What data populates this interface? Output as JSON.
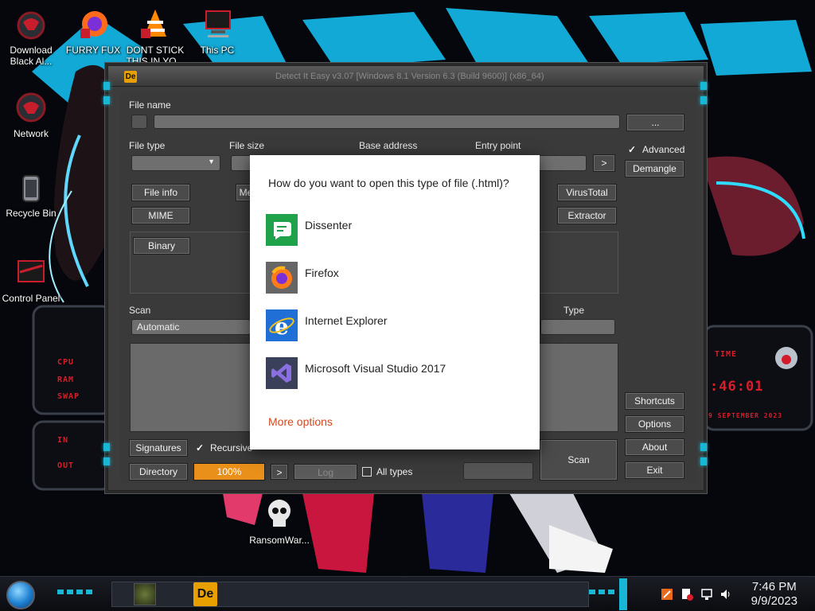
{
  "desktop": {
    "icons": [
      {
        "label": "Download Black Al..."
      },
      {
        "label": "FURRY FUX"
      },
      {
        "label": "DONT STICK THIS IN YO..."
      },
      {
        "label": "This PC"
      },
      {
        "label": "Network"
      },
      {
        "label": "Recycle Bin"
      },
      {
        "label": "Control Panel"
      },
      {
        "label": "RansomWar..."
      }
    ]
  },
  "hud_left": {
    "cpu": "CPU",
    "ram": "RAM",
    "swap": "SWAP",
    "in": "IN",
    "out": "OUT"
  },
  "hud_right": {
    "time_label": "TIME",
    "time_value": ":46:01",
    "date": "9 SEPTEMBER 2023"
  },
  "app": {
    "title": "Detect It Easy v3.07 [Windows 8.1 Version 6.3 (Build 9600)] (x86_64)",
    "logo": "De",
    "labels": {
      "file_name": "File name",
      "file_type": "File type",
      "file_size": "File size",
      "base_address": "Base address",
      "entry_point": "Entry point",
      "scan": "Scan",
      "type": "Type"
    },
    "file_name_browse": "...",
    "entry_point_go": ">",
    "advanced_label": "Advanced",
    "buttons": {
      "demangle": "Demangle",
      "file_info": "File info",
      "memory_map": "Me",
      "virustotal": "VirusTotal",
      "mime": "MIME",
      "extractor": "Extractor",
      "binary": "Binary",
      "shortcuts": "Shortcuts",
      "options": "Options",
      "about": "About",
      "exit": "Exit",
      "signatures": "Signatures",
      "directory": "Directory",
      "scan": "Scan",
      "next": ">",
      "log": "Log"
    },
    "scan_mode": "Automatic",
    "recursive_label": "Recursive",
    "all_types_label": "All types",
    "progress_text": "100%"
  },
  "open_with": {
    "title": "How do you want to open this type of file (.html)?",
    "apps": [
      {
        "name": "Dissenter",
        "icon": "dissenter-icon"
      },
      {
        "name": "Firefox",
        "icon": "firefox-icon"
      },
      {
        "name": "Internet Explorer",
        "icon": "internet-explorer-icon"
      },
      {
        "name": "Microsoft Visual Studio 2017",
        "icon": "visual-studio-icon"
      }
    ],
    "more_options": "More options"
  },
  "taskbar": {
    "pinned_app_logo": "De",
    "time": "7:46 PM",
    "date": "9/9/2023"
  },
  "colors": {
    "accent_cyan": "#19b7d6",
    "hud_red": "#d81e2a",
    "progress_orange": "#e8901a",
    "more_options_orange": "#d04a20",
    "dialog_bg": "#ffffff"
  }
}
